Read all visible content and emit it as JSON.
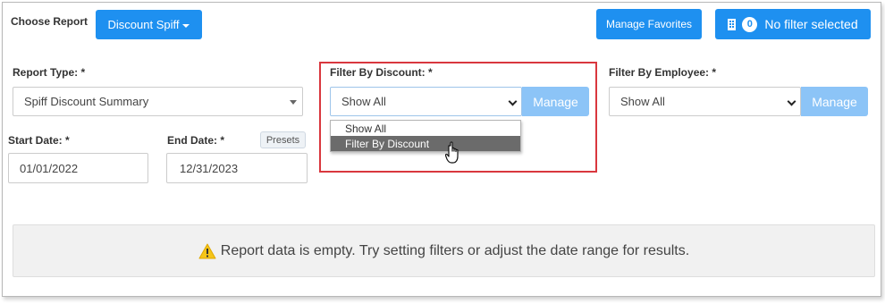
{
  "header": {
    "choose_report_label": "Choose Report",
    "report_button_label": "Discount Spiff",
    "manage_favorites_label": "Manage Favorites",
    "filter_count": "0",
    "filter_status_label": "No filter selected"
  },
  "report_type": {
    "label": "Report Type: *",
    "value": "Spiff Discount Summary"
  },
  "discount_filter": {
    "label": "Filter By Discount: *",
    "value": "Show All",
    "manage_label": "Manage",
    "options": [
      "Show All",
      "Filter By Discount"
    ],
    "highlighted_option": "Filter By Discount"
  },
  "employee_filter": {
    "label": "Filter By Employee: *",
    "value": "Show All",
    "manage_label": "Manage"
  },
  "dates": {
    "start_label": "Start Date: *",
    "start_value": "01/01/2022",
    "end_label": "End Date: *",
    "end_value": "12/31/2023",
    "presets_label": "Presets"
  },
  "alert": {
    "message": "Report data is empty. Try setting filters or adjust the date range for results.",
    "icon": "warning-icon"
  },
  "colors": {
    "primary": "#1e90f0",
    "manage_disabled": "#8cc4f7",
    "highlight_border": "#d9373e",
    "warning": "#f5c518"
  }
}
